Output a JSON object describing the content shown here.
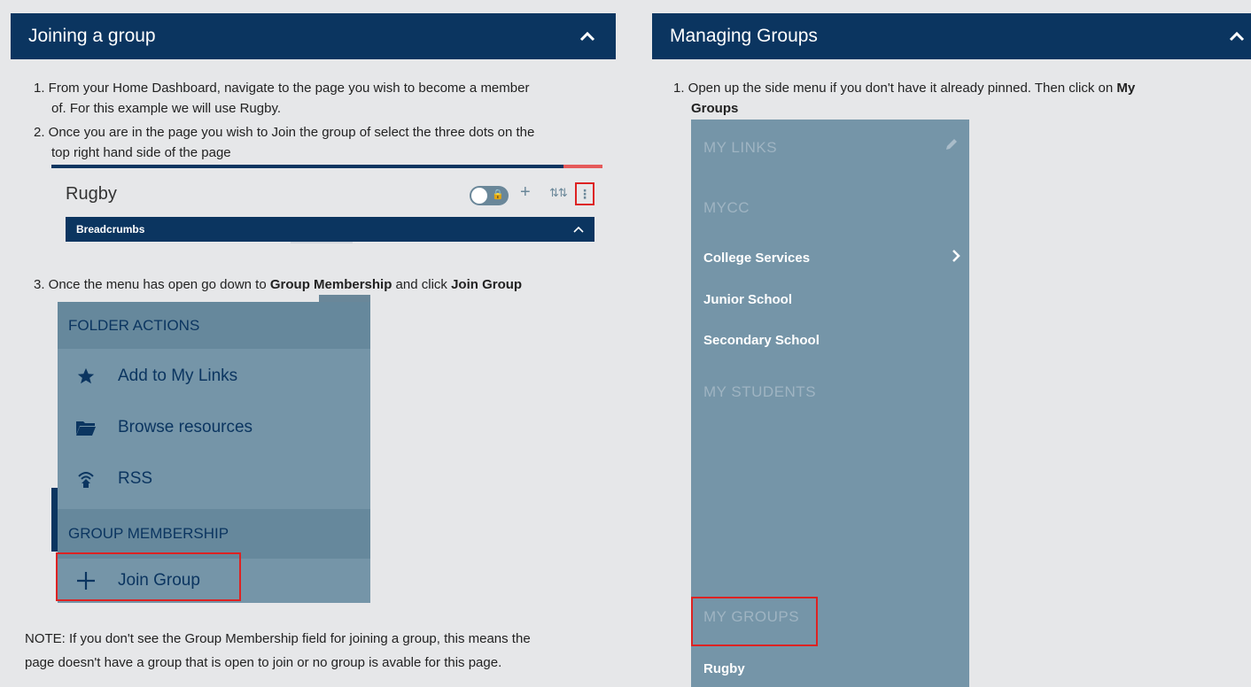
{
  "left_panel": {
    "title": "Joining a group",
    "step1_line1": "1. From your Home Dashboard, navigate to the page you wish to become a member",
    "step1_line2": "of.  For this example we will use Rugby.",
    "step2_line1": "2. Once you are in the page you wish to Join the group of select the three dots on the",
    "step2_line2": "top right hand side of the page",
    "step3_pre": "3. Once the menu has open go down to ",
    "step3_bold1": "Group Membership",
    "step3_mid": " and click ",
    "step3_bold2": "Join Group",
    "note_line1": "NOTE: If you don't see the Group Membership field for joining a group, this means the",
    "note_line2": "page doesn't have a group that is open to join or no group is avable for this page.",
    "screenshot1": {
      "page_title": "Rugby",
      "breadcrumbs_label": "Breadcrumbs"
    },
    "screenshot2": {
      "folder_actions_label": "FOLDER ACTIONS",
      "add_links_label": "Add to My Links",
      "browse_label": "Browse resources",
      "rss_label": "RSS",
      "group_membership_label": "GROUP MEMBERSHIP",
      "join_group_label": "Join Group"
    }
  },
  "right_panel": {
    "title": "Managing Groups",
    "step1_pre": "1. Open up the side menu if you don't have it already pinned. Then click on ",
    "step1_bold1": "My",
    "step1_bold2": "Groups",
    "sidemenu": {
      "my_links": "MY LINKS",
      "mycc": "MYCC",
      "college_services": "College Services",
      "junior_school": "Junior School",
      "secondary_school": "Secondary School",
      "my_students": "MY STUDENTS",
      "my_groups": "MY GROUPS",
      "rugby": "Rugby"
    }
  },
  "colors": {
    "header_bg": "#0b3560",
    "menu_bg": "#7595a8",
    "highlight_border": "#dd2222"
  }
}
